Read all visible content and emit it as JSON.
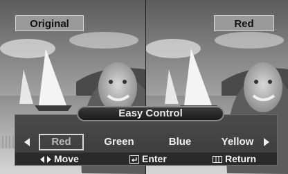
{
  "labels": {
    "left": "Original",
    "right": "Red"
  },
  "osd": {
    "title": "Easy Control",
    "options": [
      {
        "label": "Red",
        "selected": true
      },
      {
        "label": "Green",
        "selected": false
      },
      {
        "label": "Blue",
        "selected": false
      },
      {
        "label": "Yellow",
        "selected": false
      }
    ],
    "hints": {
      "move": "Move",
      "enter": "Enter",
      "return": "Return"
    }
  },
  "icons": {
    "left": "arrow-left-icon",
    "right": "arrow-right-icon",
    "move": "left-right-arrows-icon",
    "enter": "enter-icon",
    "return": "menu-return-icon"
  },
  "colors": {
    "osd_panel": "#424242",
    "label_bg": "#9a9a9a",
    "text": "#f0f0f0"
  }
}
